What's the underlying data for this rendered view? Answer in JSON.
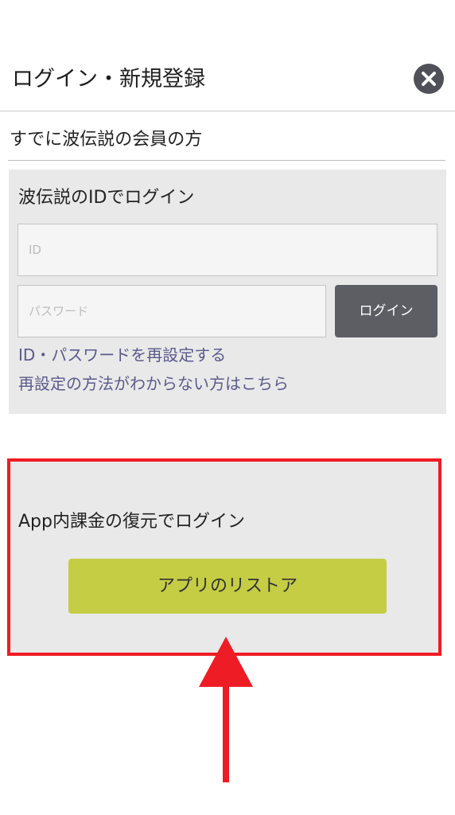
{
  "header": {
    "title": "ログイン・新規登録",
    "close_icon": "close-icon"
  },
  "member_section": {
    "title": "すでに波伝説の会員の方"
  },
  "id_login": {
    "title": "波伝説のIDでログイン",
    "id_placeholder": "ID",
    "password_placeholder": "パスワード",
    "login_button": "ログイン",
    "reset_link": "ID・パスワードを再設定する",
    "help_link": "再設定の方法がわからない方はこちら"
  },
  "restore": {
    "title": "App内課金の復元でログイン",
    "button": "アプリのリストア"
  },
  "colors": {
    "login_button_bg": "#5d5d64",
    "restore_button_bg": "#c5cd44",
    "link": "#5a5a8c",
    "annotation": "#ee1c24",
    "panel_bg": "#e9e9e9"
  },
  "annotation": {
    "type": "red highlight box with upward arrow",
    "arrow_icon": "arrow-up-icon"
  }
}
